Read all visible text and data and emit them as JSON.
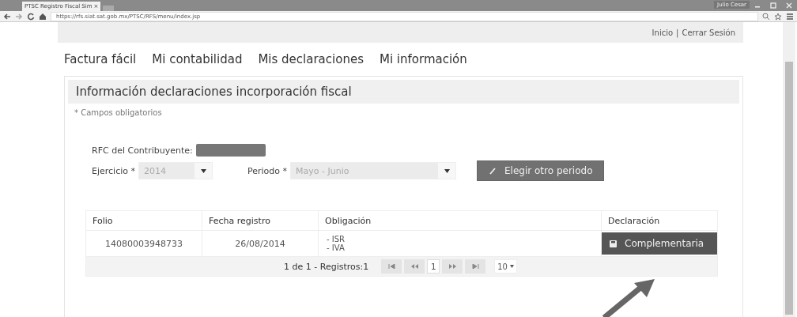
{
  "browser": {
    "tab": {
      "title": "PTSC Registro Fiscal Sim",
      "close": "×"
    },
    "user": "Julio Cesar",
    "url": "https://rfs.siat.sat.gob.mx/PTSC/RFS/menu/index.jsp"
  },
  "header": {
    "links": [
      "Inicio",
      "Cerrar Sesión"
    ],
    "separator": "|"
  },
  "nav": [
    {
      "label": "Factura fácil"
    },
    {
      "label": "Mi contabilidad"
    },
    {
      "label": "Mis declaraciones"
    },
    {
      "label": "Mi información"
    }
  ],
  "panel": {
    "title": "Información declaraciones incorporación fiscal",
    "note": "* Campos obligatorios"
  },
  "form": {
    "rfc_label": "RFC del Contribuyente:",
    "ejercicio": {
      "label": "Ejercicio *",
      "value": "2014",
      "disabled": true
    },
    "periodo": {
      "label": "Periodo *",
      "value": "Mayo - Junio",
      "disabled": true
    },
    "button": "Elegir otro periodo"
  },
  "table": {
    "columns": [
      "Folio",
      "Fecha registro",
      "Obligación",
      "Declaración"
    ],
    "rows": [
      {
        "folio": "14080003948733",
        "fecha": "26/08/2014",
        "obligaciones": [
          "- ISR",
          "- IVA"
        ],
        "action": "Complementaria"
      }
    ],
    "pager": {
      "summary": "1 de 1 - Registros:1",
      "page": "1",
      "per_page": "10"
    }
  }
}
